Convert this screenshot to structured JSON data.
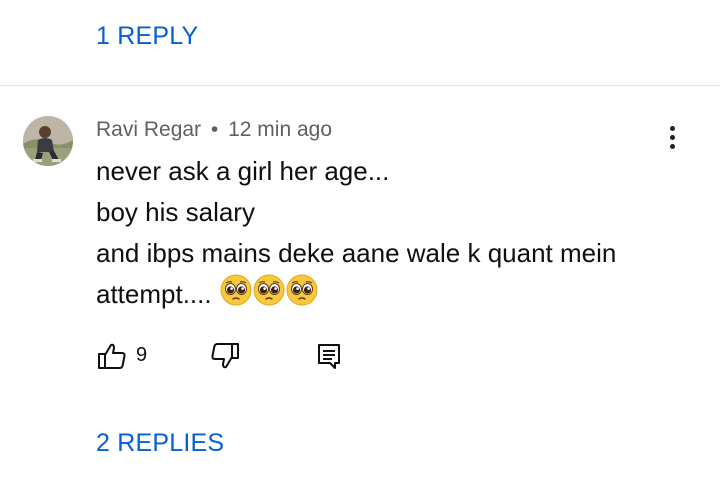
{
  "top_replies_link": "1 REPLY",
  "comment": {
    "author": "Ravi Regar",
    "separator": "•",
    "time": "12 min ago",
    "lines": [
      "never ask a girl her age...",
      "boy his salary",
      "and ibps mains deke aane wale k quant mein",
      "attempt...."
    ],
    "emoji_name": "pleading-face-emoji",
    "emoji_count": 3,
    "like_count": "9"
  },
  "bottom_replies_link": "2 REPLIES",
  "icons": {
    "like": "thumbs-up-icon",
    "dislike": "thumbs-down-icon",
    "reply": "reply-comment-icon",
    "menu": "more-vertical-icon"
  },
  "colors": {
    "link": "#065fd4",
    "meta": "#606060",
    "text": "#0f0f0f",
    "divider": "#e5e5e5"
  }
}
